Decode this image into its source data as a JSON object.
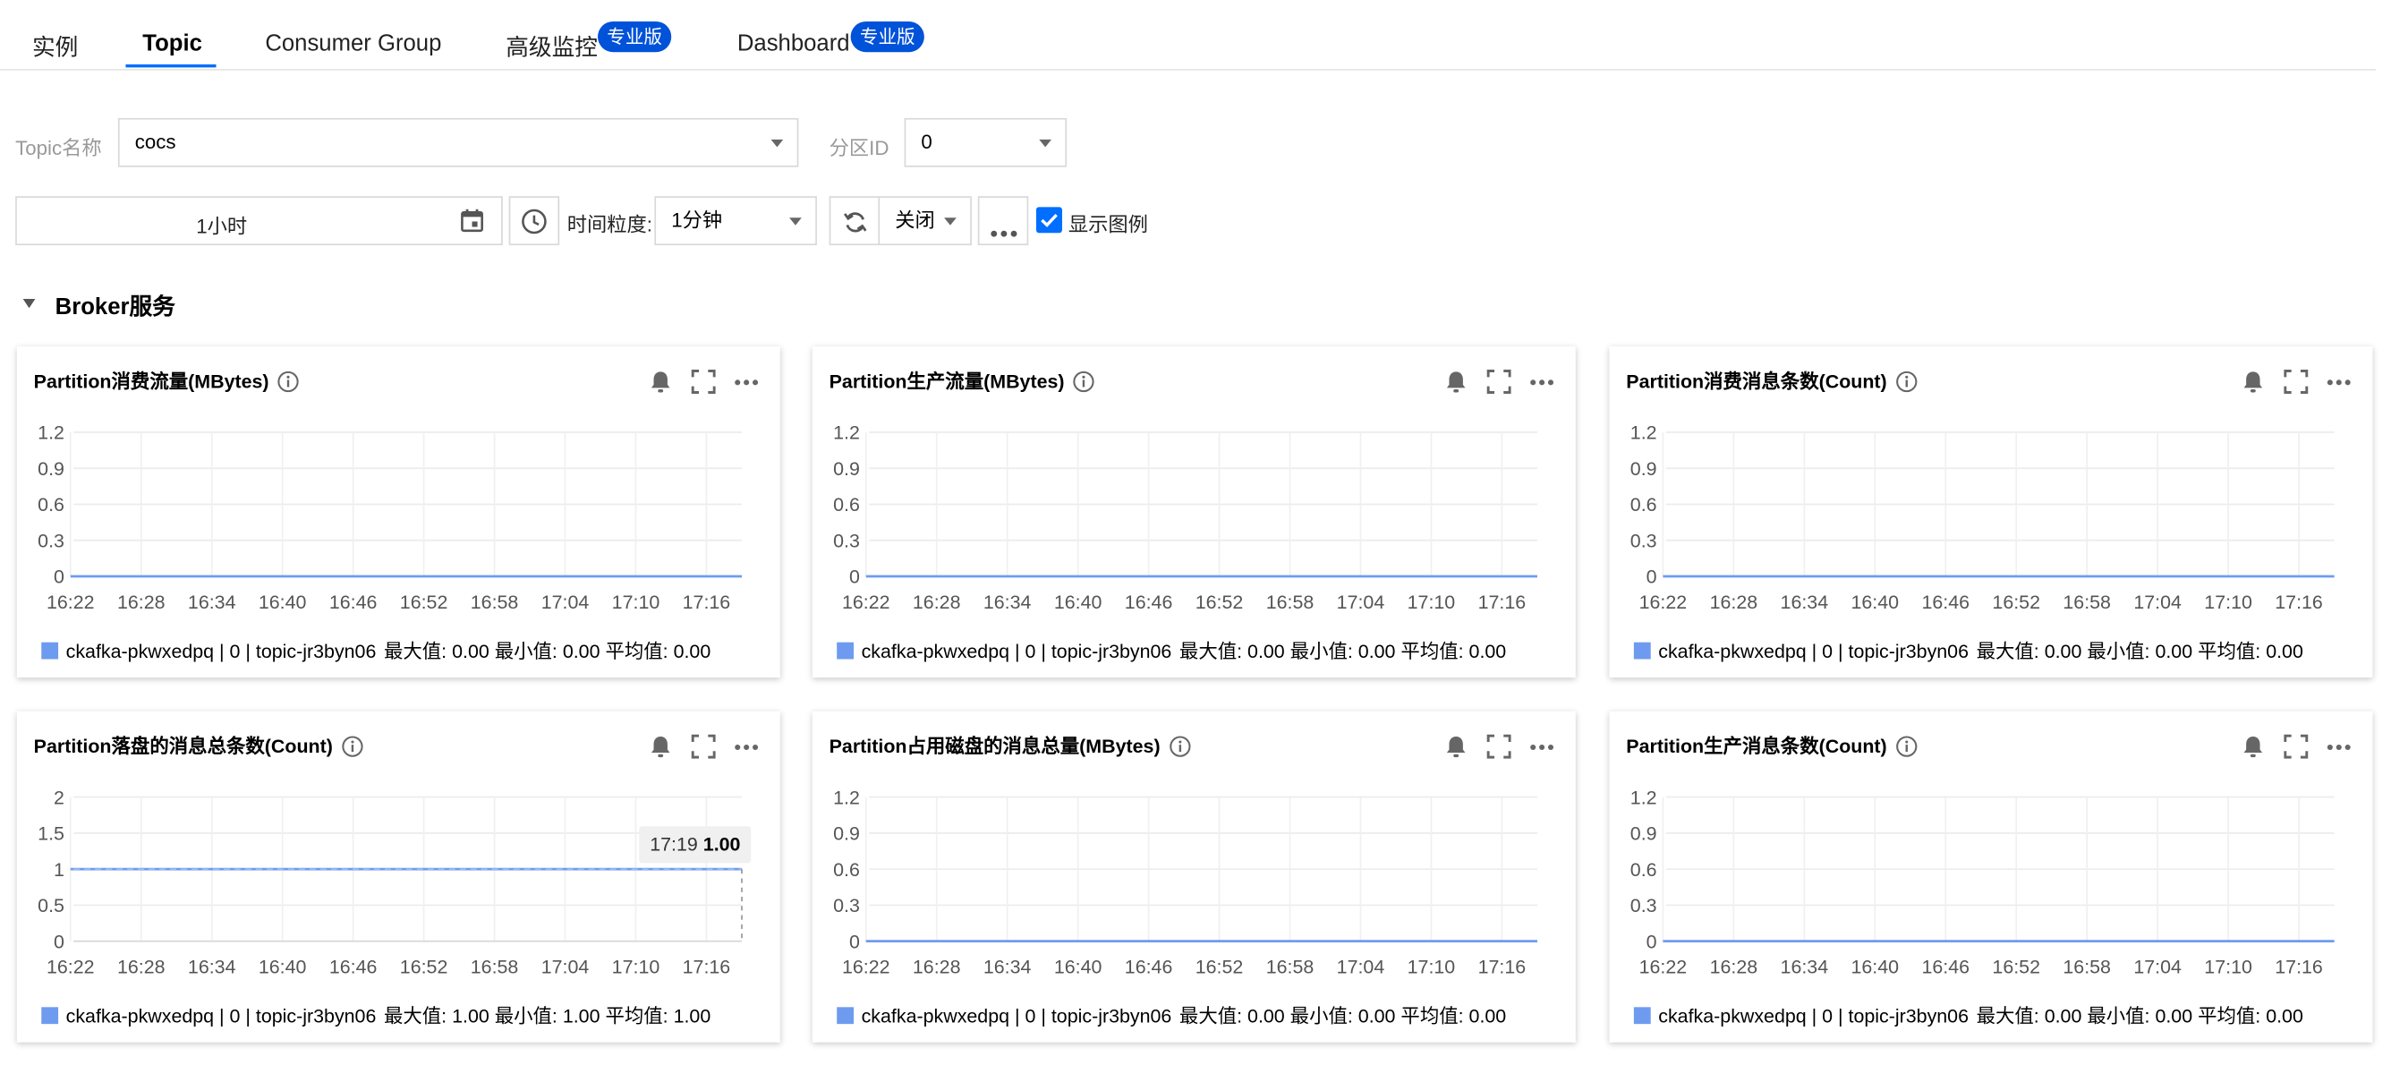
{
  "tabs": [
    {
      "label": "实例"
    },
    {
      "label": "Topic"
    },
    {
      "label": "Consumer Group"
    },
    {
      "label": "高级监控",
      "badge": "专业版"
    },
    {
      "label": "Dashboard",
      "badge": "专业版"
    }
  ],
  "active_tab": "Topic",
  "filters": {
    "topic_label": "Topic名称",
    "topic_value": "cocs",
    "partition_label": "分区ID",
    "partition_value": "0"
  },
  "toolbar": {
    "time_range": "1小时",
    "granularity_label": "时间粒度:",
    "granularity_value": "1分钟",
    "refresh_value": "关闭",
    "show_legend_label": "显示图例",
    "show_legend_checked": true
  },
  "section": {
    "title": "Broker服务",
    "expanded": true
  },
  "icons": [
    "calendar-icon",
    "clock-icon",
    "refresh-icon",
    "more-icon",
    "checkbox-icon",
    "info-icon",
    "bell-icon",
    "fullscreen-icon",
    "chevron-down-icon"
  ],
  "colors": {
    "accent": "#006eff",
    "badge": "#0052d9",
    "series": "#6e9bef"
  },
  "chart_data": [
    {
      "type": "line",
      "title": "Partition消费流量(MBytes)",
      "x": [
        "16:22",
        "16:28",
        "16:34",
        "16:40",
        "16:46",
        "16:52",
        "16:58",
        "17:04",
        "17:10",
        "17:16"
      ],
      "ylim": [
        0,
        1.2
      ],
      "yticks": [
        "0",
        "0.3",
        "0.6",
        "0.9",
        "1.2"
      ],
      "series": [
        {
          "name": "ckafka-pkwxedpq | 0 | topic-jr3byn06",
          "values": [
            0,
            0,
            0,
            0,
            0,
            0,
            0,
            0,
            0,
            0
          ]
        }
      ],
      "legend": {
        "series": "ckafka-pkwxedpq | 0 | topic-jr3byn06",
        "stats": "最大值: 0.00  最小值: 0.00  平均值: 0.00"
      }
    },
    {
      "type": "line",
      "title": "Partition生产流量(MBytes)",
      "x": [
        "16:22",
        "16:28",
        "16:34",
        "16:40",
        "16:46",
        "16:52",
        "16:58",
        "17:04",
        "17:10",
        "17:16"
      ],
      "ylim": [
        0,
        1.2
      ],
      "yticks": [
        "0",
        "0.3",
        "0.6",
        "0.9",
        "1.2"
      ],
      "series": [
        {
          "name": "ckafka-pkwxedpq | 0 | topic-jr3byn06",
          "values": [
            0,
            0,
            0,
            0,
            0,
            0,
            0,
            0,
            0,
            0
          ]
        }
      ],
      "legend": {
        "series": "ckafka-pkwxedpq | 0 | topic-jr3byn06",
        "stats": "最大值: 0.00  最小值: 0.00  平均值: 0.00"
      }
    },
    {
      "type": "line",
      "title": "Partition消费消息条数(Count)",
      "x": [
        "16:22",
        "16:28",
        "16:34",
        "16:40",
        "16:46",
        "16:52",
        "16:58",
        "17:04",
        "17:10",
        "17:16"
      ],
      "ylim": [
        0,
        1.2
      ],
      "yticks": [
        "0",
        "0.3",
        "0.6",
        "0.9",
        "1.2"
      ],
      "series": [
        {
          "name": "ckafka-pkwxedpq | 0 | topic-jr3byn06",
          "values": [
            0,
            0,
            0,
            0,
            0,
            0,
            0,
            0,
            0,
            0
          ]
        }
      ],
      "legend": {
        "series": "ckafka-pkwxedpq | 0 | topic-jr3byn06",
        "stats": "最大值: 0.00  最小值: 0.00  平均值: 0.00"
      }
    },
    {
      "type": "line",
      "title": "Partition落盘的消息总条数(Count)",
      "x": [
        "16:22",
        "16:28",
        "16:34",
        "16:40",
        "16:46",
        "16:52",
        "16:58",
        "17:04",
        "17:10",
        "17:16"
      ],
      "ylim": [
        0,
        2
      ],
      "yticks": [
        "0",
        "0.5",
        "1",
        "1.5",
        "2"
      ],
      "series": [
        {
          "name": "ckafka-pkwxedpq | 0 | topic-jr3byn06",
          "values": [
            1,
            1,
            1,
            1,
            1,
            1,
            1,
            1,
            1,
            1
          ]
        }
      ],
      "tooltip": {
        "time": "17:19",
        "value": "1.00"
      },
      "legend": {
        "series": "ckafka-pkwxedpq | 0 | topic-jr3byn06",
        "stats": "最大值: 1.00  最小值: 1.00  平均值: 1.00"
      }
    },
    {
      "type": "line",
      "title": "Partition占用磁盘的消息总量(MBytes)",
      "x": [
        "16:22",
        "16:28",
        "16:34",
        "16:40",
        "16:46",
        "16:52",
        "16:58",
        "17:04",
        "17:10",
        "17:16"
      ],
      "ylim": [
        0,
        1.2
      ],
      "yticks": [
        "0",
        "0.3",
        "0.6",
        "0.9",
        "1.2"
      ],
      "series": [
        {
          "name": "ckafka-pkwxedpq | 0 | topic-jr3byn06",
          "values": [
            0,
            0,
            0,
            0,
            0,
            0,
            0,
            0,
            0,
            0
          ]
        }
      ],
      "legend": {
        "series": "ckafka-pkwxedpq | 0 | topic-jr3byn06",
        "stats": "最大值: 0.00  最小值: 0.00  平均值: 0.00"
      }
    },
    {
      "type": "line",
      "title": "Partition生产消息条数(Count)",
      "x": [
        "16:22",
        "16:28",
        "16:34",
        "16:40",
        "16:46",
        "16:52",
        "16:58",
        "17:04",
        "17:10",
        "17:16"
      ],
      "ylim": [
        0,
        1.2
      ],
      "yticks": [
        "0",
        "0.3",
        "0.6",
        "0.9",
        "1.2"
      ],
      "series": [
        {
          "name": "ckafka-pkwxedpq | 0 | topic-jr3byn06",
          "values": [
            0,
            0,
            0,
            0,
            0,
            0,
            0,
            0,
            0,
            0
          ]
        }
      ],
      "legend": {
        "series": "ckafka-pkwxedpq | 0 | topic-jr3byn06",
        "stats": "最大值: 0.00  最小值: 0.00  平均值: 0.00"
      }
    }
  ]
}
